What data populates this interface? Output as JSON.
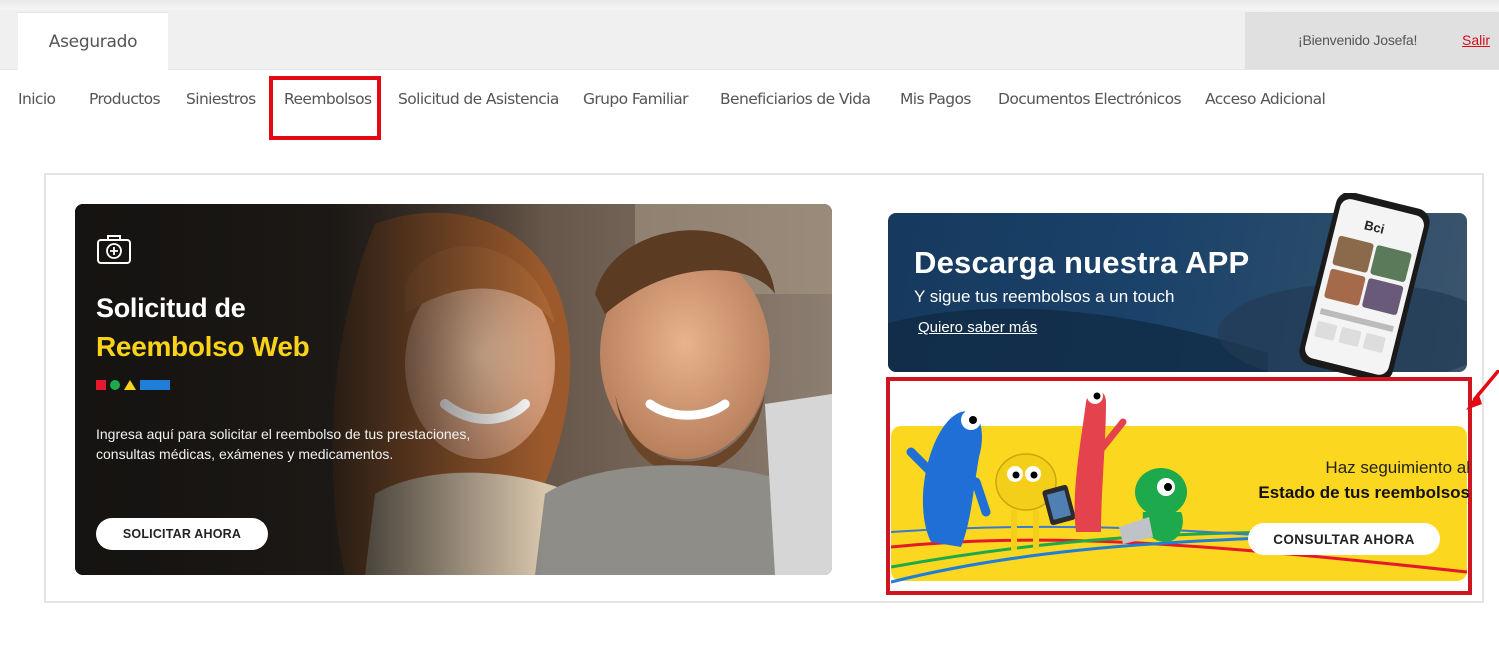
{
  "header": {
    "tab_label": "Asegurado",
    "welcome": "¡Bienvenido Josefa!",
    "logout": "Salir"
  },
  "nav": {
    "items": [
      {
        "label": "Inicio"
      },
      {
        "label": "Productos"
      },
      {
        "label": "Siniestros"
      },
      {
        "label": "Reembolsos",
        "highlighted": true
      },
      {
        "label": "Solicitud de Asistencia"
      },
      {
        "label": "Grupo Familiar"
      },
      {
        "label": "Beneficiarios de Vida"
      },
      {
        "label": "Mis Pagos"
      },
      {
        "label": "Documentos Electrónicos"
      },
      {
        "label": "Acceso Adicional"
      }
    ]
  },
  "banner_web": {
    "title_line1": "Solicitud de",
    "title_line2": "Reembolso Web",
    "description": "Ingresa aquí para solicitar el reembolso de tus prestaciones,  consultas médicas, exámenes y medicamentos.",
    "button": "SOLICITAR AHORA"
  },
  "banner_app": {
    "title": "Descarga nuestra APP",
    "subtitle": "Y sigue tus reembolsos a un touch",
    "link": "Quiero saber más",
    "phone_brand": "Bci"
  },
  "banner_status": {
    "line1": "Haz seguimiento al",
    "line2": "Estado de tus reembolsos",
    "button": "CONSULTAR AHORA"
  },
  "colors": {
    "highlight_red": "#e50914",
    "brand_yellow": "#f9d21c",
    "app_blue": "#16395e",
    "link_red": "#d0101a"
  }
}
